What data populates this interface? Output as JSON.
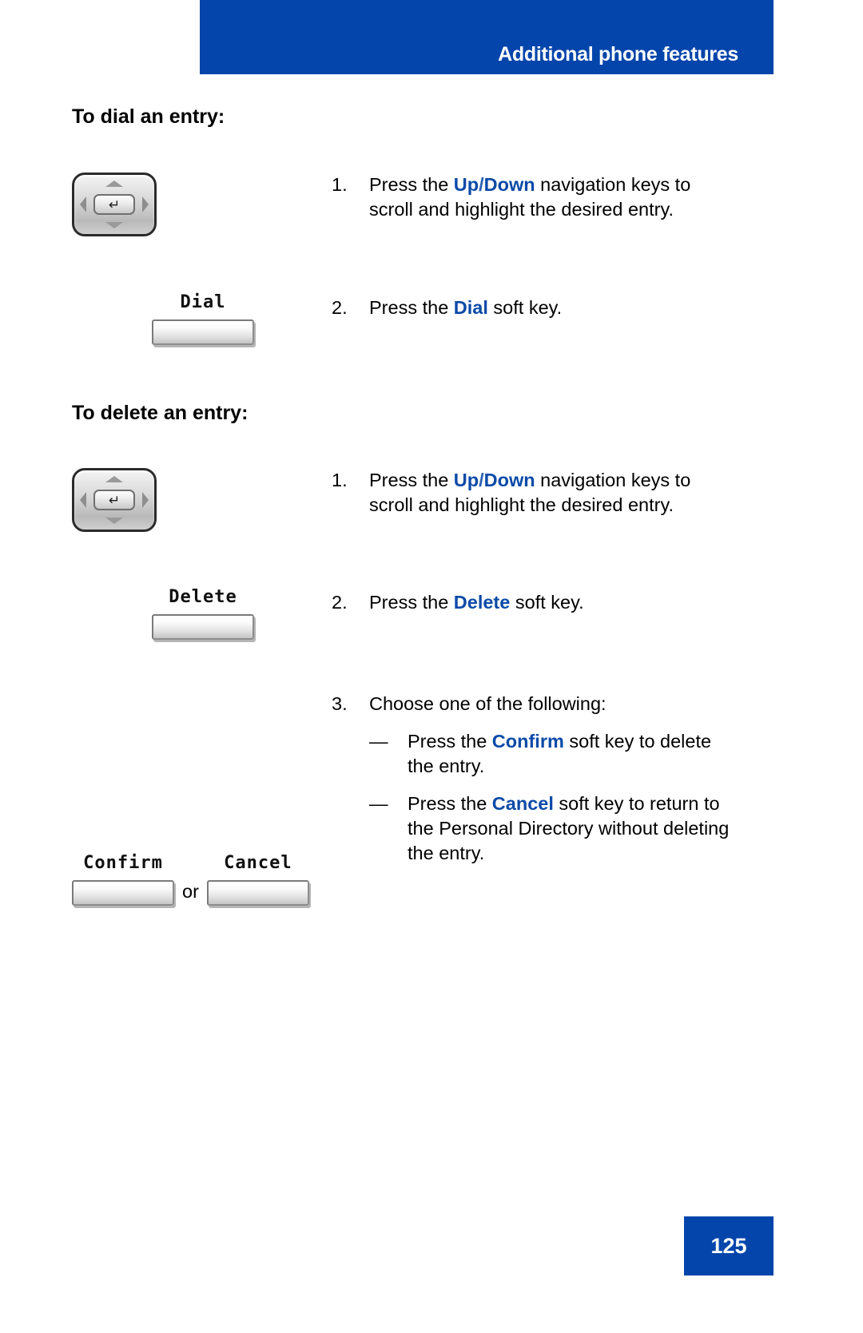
{
  "header": {
    "title": "Additional phone features",
    "band_color": "#0445ab"
  },
  "sections": [
    {
      "heading": "To dial an entry:",
      "steps": [
        {
          "number": "1.",
          "text_parts": [
            {
              "t": "Press the ",
              "style": "plain"
            },
            {
              "t": "Up",
              "style": "keyword"
            },
            {
              "t": "/",
              "style": "keyword-sep"
            },
            {
              "t": "Down",
              "style": "keyword"
            },
            {
              "t": " navigation keys to scroll and highlight the desired entry.",
              "style": "plain"
            }
          ],
          "text_plain": "Press the Up/Down navigation keys to scroll and highlight the desired entry.",
          "art": "navigation-key-cluster"
        },
        {
          "number": "2.",
          "text_parts": [
            {
              "t": "Press the ",
              "style": "plain"
            },
            {
              "t": "Dial",
              "style": "keyword"
            },
            {
              "t": " soft key.",
              "style": "plain"
            }
          ],
          "text_plain": "Press the Dial soft key.",
          "art": "soft-key",
          "softkey_label": "Dial"
        }
      ]
    },
    {
      "heading": "To delete an entry:",
      "steps": [
        {
          "number": "1.",
          "text_parts": [
            {
              "t": "Press the ",
              "style": "plain"
            },
            {
              "t": "Up",
              "style": "keyword"
            },
            {
              "t": "/",
              "style": "keyword-sep"
            },
            {
              "t": "Down",
              "style": "keyword"
            },
            {
              "t": " navigation keys to scroll and highlight the desired entry.",
              "style": "plain"
            }
          ],
          "text_plain": "Press the Up/Down navigation keys to scroll and highlight the desired entry.",
          "art": "navigation-key-cluster"
        },
        {
          "number": "2.",
          "text_parts": [
            {
              "t": "Press the ",
              "style": "plain"
            },
            {
              "t": "Delete",
              "style": "keyword"
            },
            {
              "t": " soft key.",
              "style": "plain"
            }
          ],
          "text_plain": "Press the Delete soft key.",
          "art": "soft-key",
          "softkey_label": "Delete"
        },
        {
          "number": "3.",
          "text_plain": "Choose one of the following:",
          "art": "two-soft-keys",
          "softkey_label_left": "Confirm",
          "softkey_label_right": "Cancel",
          "or_label": "or",
          "sub_items": [
            {
              "dash": "—",
              "parts": [
                {
                  "t": "Press the ",
                  "style": "plain"
                },
                {
                  "t": "Confirm",
                  "style": "keyword"
                },
                {
                  "t": " soft key to delete the entry.",
                  "style": "plain"
                }
              ],
              "plain": "Press the Confirm soft key to delete the entry."
            },
            {
              "dash": "—",
              "parts": [
                {
                  "t": "Press the ",
                  "style": "plain"
                },
                {
                  "t": "Cancel",
                  "style": "keyword"
                },
                {
                  "t": " soft key to return to the Personal Directory without deleting the entry.",
                  "style": "plain"
                }
              ],
              "plain": "Press the Cancel soft key to return to the Personal Directory without deleting the entry."
            }
          ]
        }
      ]
    }
  ],
  "footer": {
    "page_number": "125",
    "box_color": "#0445ab"
  },
  "icons": {
    "nav_enter_glyph": "↵"
  }
}
